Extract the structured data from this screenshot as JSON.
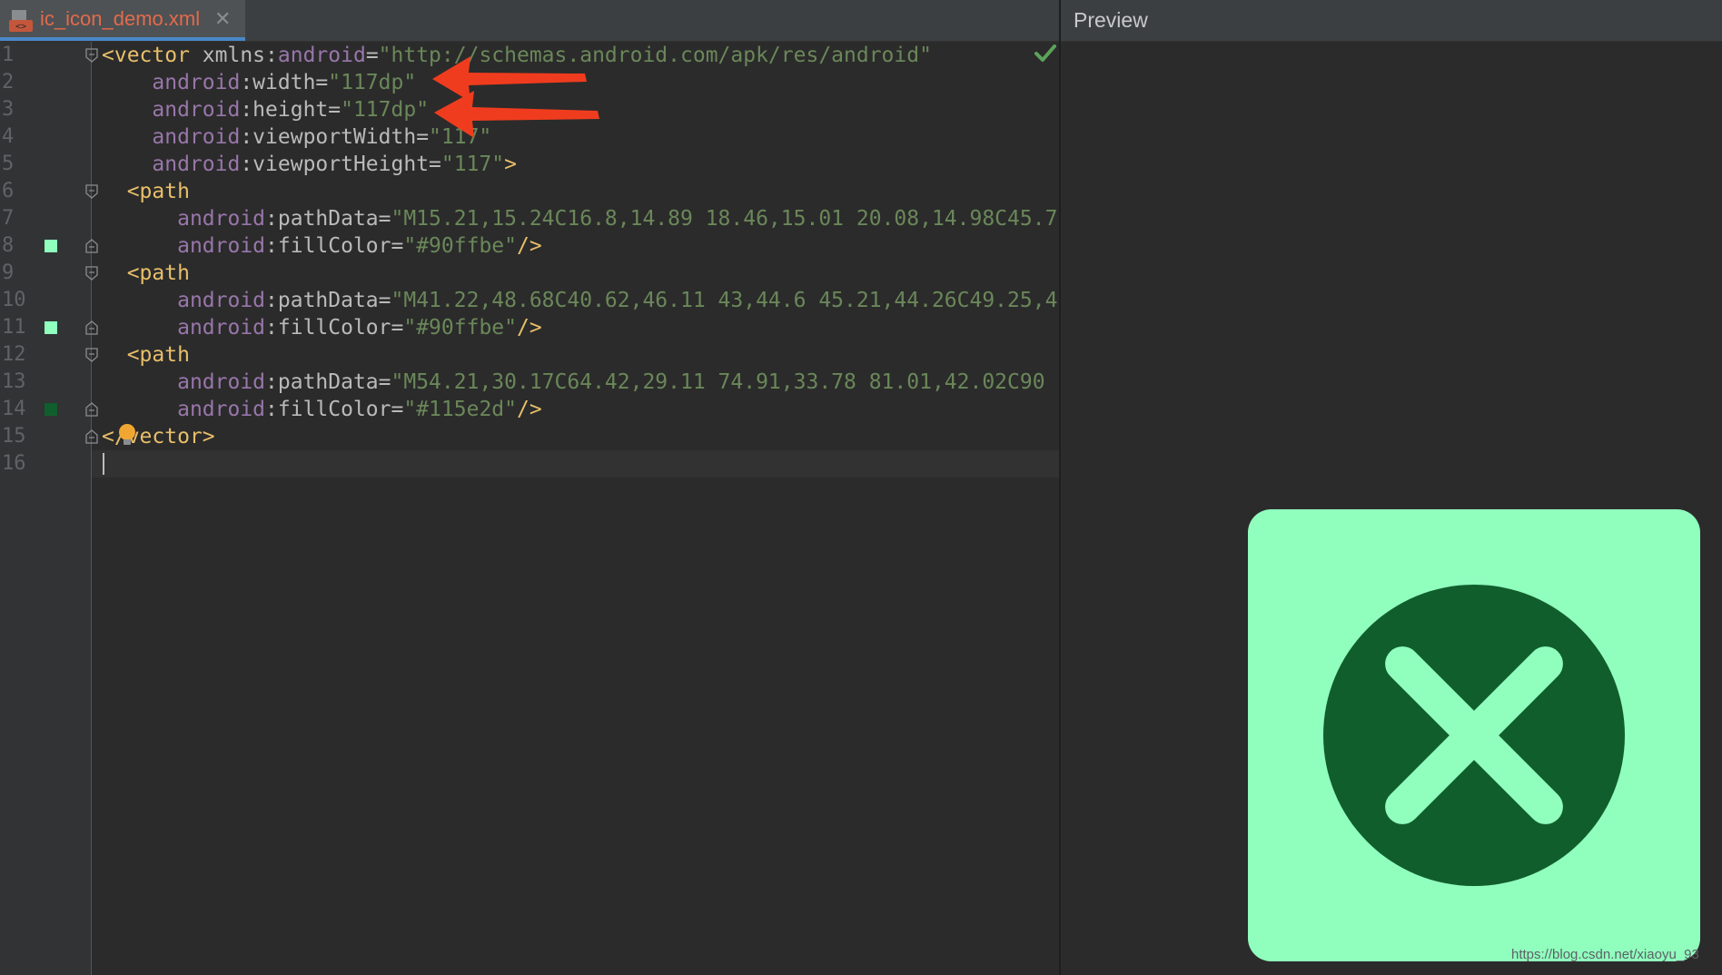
{
  "editor": {
    "tab": {
      "filename": "ic_icon_demo.xml",
      "close": "✕"
    },
    "lines": [
      {
        "n": "1",
        "code": [
          {
            "t": "<vector ",
            "c": "tag"
          },
          {
            "t": "xmlns:",
            "c": "attr"
          },
          {
            "t": "android",
            "c": "ns"
          },
          {
            "t": "=",
            "c": "attr"
          },
          {
            "t": "\"http://schemas.android.com/apk/res/android\"",
            "c": "val"
          }
        ]
      },
      {
        "n": "2",
        "code": [
          {
            "t": "    ",
            "c": "attr"
          },
          {
            "t": "android",
            "c": "ns"
          },
          {
            "t": ":width=",
            "c": "attr"
          },
          {
            "t": "\"117dp\"",
            "c": "val"
          }
        ]
      },
      {
        "n": "3",
        "code": [
          {
            "t": "    ",
            "c": "attr"
          },
          {
            "t": "android",
            "c": "ns"
          },
          {
            "t": ":height=",
            "c": "attr"
          },
          {
            "t": "\"117dp\"",
            "c": "val"
          }
        ]
      },
      {
        "n": "4",
        "code": [
          {
            "t": "    ",
            "c": "attr"
          },
          {
            "t": "android",
            "c": "ns"
          },
          {
            "t": ":viewportWidth=",
            "c": "attr"
          },
          {
            "t": "\"117\"",
            "c": "val"
          }
        ]
      },
      {
        "n": "5",
        "code": [
          {
            "t": "    ",
            "c": "attr"
          },
          {
            "t": "android",
            "c": "ns"
          },
          {
            "t": ":viewportHeight=",
            "c": "attr"
          },
          {
            "t": "\"117\"",
            "c": "val"
          },
          {
            "t": ">",
            "c": "tag"
          }
        ]
      },
      {
        "n": "6",
        "code": [
          {
            "t": "  <path",
            "c": "tag"
          }
        ]
      },
      {
        "n": "7",
        "code": [
          {
            "t": "      ",
            "c": "attr"
          },
          {
            "t": "android",
            "c": "ns"
          },
          {
            "t": ":pathData=",
            "c": "attr"
          },
          {
            "t": "\"M15.21,15.24C16.8,14.89 18.46,15.01 20.08,14.98C45.7",
            "c": "val"
          }
        ]
      },
      {
        "n": "8",
        "code": [
          {
            "t": "      ",
            "c": "attr"
          },
          {
            "t": "android",
            "c": "ns"
          },
          {
            "t": ":fillColor=",
            "c": "attr"
          },
          {
            "t": "\"#90ffbe\"",
            "c": "val"
          },
          {
            "t": "/>",
            "c": "tag"
          }
        ]
      },
      {
        "n": "9",
        "code": [
          {
            "t": "  <path",
            "c": "tag"
          }
        ]
      },
      {
        "n": "10",
        "code": [
          {
            "t": "      ",
            "c": "attr"
          },
          {
            "t": "android",
            "c": "ns"
          },
          {
            "t": ":pathData=",
            "c": "attr"
          },
          {
            "t": "\"M41.22,48.68C40.62,46.11 43,44.6 45.21,44.26C49.25,4",
            "c": "val"
          }
        ]
      },
      {
        "n": "11",
        "code": [
          {
            "t": "      ",
            "c": "attr"
          },
          {
            "t": "android",
            "c": "ns"
          },
          {
            "t": ":fillColor=",
            "c": "attr"
          },
          {
            "t": "\"#90ffbe\"",
            "c": "val"
          },
          {
            "t": "/>",
            "c": "tag"
          }
        ]
      },
      {
        "n": "12",
        "code": [
          {
            "t": "  <path",
            "c": "tag"
          }
        ]
      },
      {
        "n": "13",
        "code": [
          {
            "t": "      ",
            "c": "attr"
          },
          {
            "t": "android",
            "c": "ns"
          },
          {
            "t": ":pathData=",
            "c": "attr"
          },
          {
            "t": "\"M54.21,30.17C64.42,29.11 74.91,33.78 81.01,42.02C90",
            "c": "val"
          }
        ]
      },
      {
        "n": "14",
        "code": [
          {
            "t": "      ",
            "c": "attr"
          },
          {
            "t": "android",
            "c": "ns"
          },
          {
            "t": ":fillColor=",
            "c": "attr"
          },
          {
            "t": "\"#115e2d\"",
            "c": "val"
          },
          {
            "t": "/>",
            "c": "tag"
          }
        ]
      },
      {
        "n": "15",
        "code": [
          {
            "t": "</vector>",
            "c": "tag"
          }
        ]
      },
      {
        "n": "16",
        "code": []
      }
    ],
    "swatches": [
      {
        "line": 8,
        "color": "#90ffbe"
      },
      {
        "line": 11,
        "color": "#90ffbe"
      },
      {
        "line": 14,
        "color": "#115e2d"
      }
    ],
    "folds": [
      {
        "line": 1,
        "dir": "open"
      },
      {
        "line": 6,
        "dir": "open"
      },
      {
        "line": 8,
        "dir": "close"
      },
      {
        "line": 9,
        "dir": "open"
      },
      {
        "line": 11,
        "dir": "close"
      },
      {
        "line": 12,
        "dir": "open"
      },
      {
        "line": 14,
        "dir": "close"
      },
      {
        "line": 15,
        "dir": "close"
      }
    ]
  },
  "preview": {
    "title": "Preview",
    "icon_colors": {
      "background": "#90ffbe",
      "circle": "#115e2d",
      "cross": "#90ffbe"
    }
  },
  "annotation_color": "#f03c1e",
  "watermark": "https://blog.csdn.net/xiaoyu_93"
}
